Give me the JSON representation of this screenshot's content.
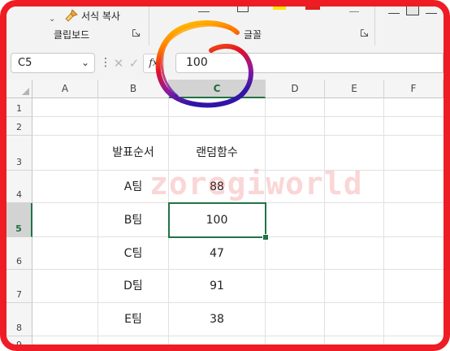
{
  "ribbon": {
    "format_painter_label": "서식 복사",
    "clipboard_label": "클립보드",
    "font_label": "글꼴"
  },
  "formula_bar": {
    "name_box": "C5",
    "fx_label": "fx",
    "formula_value": "100"
  },
  "grid": {
    "columns": [
      "A",
      "B",
      "C",
      "D",
      "E",
      "F"
    ],
    "rows": [
      "1",
      "2",
      "3",
      "4",
      "5",
      "6",
      "7",
      "8",
      "9"
    ],
    "header_row": [
      "발표순서",
      "랜덤함수"
    ],
    "data": [
      {
        "team": "A팀",
        "value": "88"
      },
      {
        "team": "B팀",
        "value": "100"
      },
      {
        "team": "C팀",
        "value": "47"
      },
      {
        "team": "D팀",
        "value": "91"
      },
      {
        "team": "E팀",
        "value": "38"
      }
    ],
    "active_cell": "C5"
  },
  "watermark": "zoregiworld",
  "colors": {
    "frame": "#ee1c24",
    "selection": "#217346",
    "watermark": "#e84646"
  }
}
